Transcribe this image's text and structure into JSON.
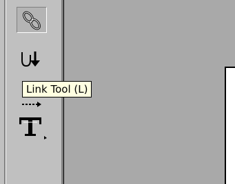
{
  "toolbox": {
    "tools": [
      {
        "name": "link-tool",
        "icon": "chain-link-icon",
        "pressed": true
      },
      {
        "name": "unlink-tool",
        "icon": "unlink-arrow-icon",
        "pressed": false
      },
      {
        "name": "hidden-tool",
        "icon": "arrow-icon",
        "pressed": false
      },
      {
        "name": "text-tool",
        "icon": "type-t-icon",
        "pressed": false,
        "has_flyout": true
      }
    ]
  },
  "tooltip": {
    "text": "Link Tool (L)"
  },
  "colors": {
    "chrome": "#c0c0c0",
    "canvas": "#a9a9a9",
    "tooltip_bg": "#ffffe1"
  }
}
